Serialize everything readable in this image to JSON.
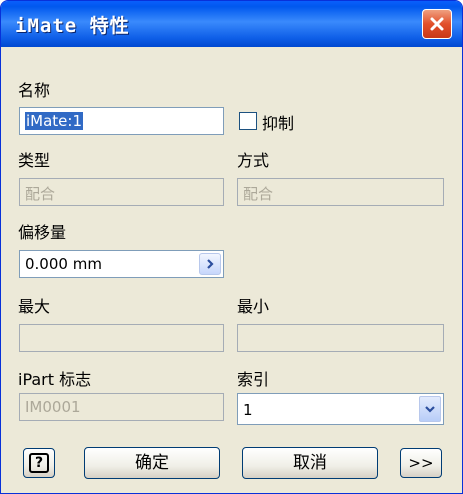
{
  "window": {
    "title": "iMate 特性"
  },
  "name": {
    "label": "名称",
    "value": "iMate:1"
  },
  "suppress": {
    "label": "抑制",
    "checked": false
  },
  "type": {
    "label": "类型",
    "value": "配合"
  },
  "mode": {
    "label": "方式",
    "value": "配合"
  },
  "offset": {
    "label": "偏移量",
    "value": "0.000 mm"
  },
  "max": {
    "label": "最大",
    "value": ""
  },
  "min": {
    "label": "最小",
    "value": ""
  },
  "ipart_flag": {
    "label": "iPart 标志",
    "value": "IM0001"
  },
  "index": {
    "label": "索引",
    "value": "1"
  },
  "buttons": {
    "help": "?",
    "ok": "确定",
    "cancel": "取消",
    "more": ">>"
  },
  "icons": {
    "close": "close-icon",
    "spin": "chevron-right-icon",
    "dropdown": "chevron-down-icon",
    "help": "help-icon"
  },
  "colors": {
    "titlebar": "#0058ee",
    "close_button": "#e2502b",
    "dialog_background": "#ece9d8",
    "selection": "#316ac5"
  }
}
